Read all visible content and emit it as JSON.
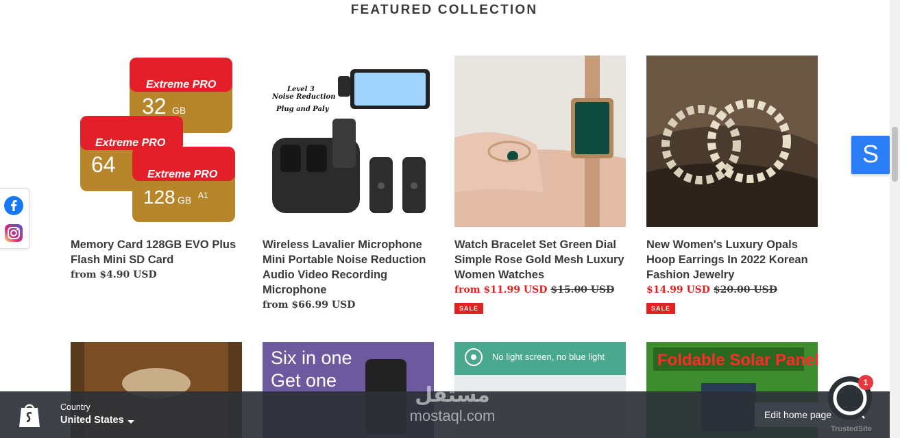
{
  "section": {
    "title": "FEATURED COLLECTION"
  },
  "products": [
    {
      "title": "Memory Card 128GB EVO Plus Flash Mini SD Card",
      "price": "from $4.90 USD",
      "compare": "",
      "badge": ""
    },
    {
      "title": "Wireless Lavalier Microphone Mini Portable Noise Reduction Audio Video Recording Microphone",
      "price": "from $66.99 USD",
      "compare": "",
      "badge": ""
    },
    {
      "title": "Watch Bracelet Set Green Dial Simple Rose Gold Mesh Luxury Women Watches",
      "price": "from $11.99 USD",
      "compare": "$15.00 USD",
      "badge": "SALE"
    },
    {
      "title": "New Women's Luxury Opals Hoop Earrings In 2022 Korean Fashion Jewelry",
      "price": "$14.99 USD",
      "compare": "$20.00 USD",
      "badge": "SALE"
    }
  ],
  "product_images": {
    "sd_card": {
      "brand": "Extreme PRO",
      "capacities": [
        "32",
        "64",
        "128"
      ],
      "unit": "GB",
      "class": "A1"
    },
    "microphone": {
      "line1": "Level 3",
      "line2": "Noise Reduction",
      "line3": "Plug and Paly"
    },
    "light_panel": {
      "text": "No light screen, no blue light"
    },
    "solar_panel": {
      "text": "Foldable Solar Panel"
    },
    "six_in_one": {
      "line1": "Six in one",
      "line2": "Get one"
    }
  },
  "floating": {
    "s_button": "S"
  },
  "bottom_bar": {
    "country_label": "Country",
    "country_value": "United States",
    "edit_button": "Edit home page",
    "chat_badge": "1"
  },
  "watermark": {
    "arabic": "مستقل",
    "latin": "mostaql.com"
  },
  "trusted": "TrustedSite",
  "colors": {
    "sale": "#e22120",
    "s_button": "#2a7df5",
    "bar": "#2c3137"
  },
  "icons": [
    "facebook-icon",
    "instagram-icon",
    "shopify-bag-icon",
    "close-icon",
    "chat-icon",
    "caret-down-icon"
  ]
}
